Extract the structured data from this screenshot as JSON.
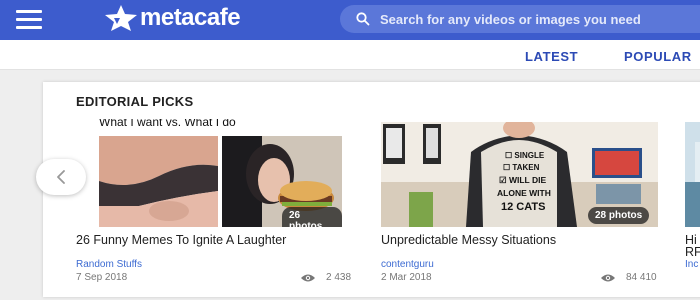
{
  "header": {
    "logo_text": "metacafe",
    "search_placeholder": "Search for any videos or images you need"
  },
  "nav": {
    "latest": "LATEST",
    "popular": "POPULAR"
  },
  "section": {
    "title": "EDITORIAL PICKS"
  },
  "items": [
    {
      "image_caption": "What I want vs. What I do",
      "badge": "26 photos",
      "title": "26 Funny Memes To Ignite A Laughter",
      "source": "Random Stuffs",
      "date": "7 Sep 2018",
      "views": "2 438"
    },
    {
      "image_caption": "☐ SINGLE ☐ TAKEN ☑ WILL DIE ALONE WITH 12 CATS",
      "badge": "28 photos",
      "title": "Unpredictable Messy Situations",
      "source": "contentguru",
      "date": "2 Mar 2018",
      "views": "84 410"
    },
    {
      "title": "Hi",
      "title_line2": "RF",
      "source": "Inc"
    }
  ],
  "colors": {
    "header_bg": "#3d5ccd",
    "link": "#3d6bd2",
    "nav": "#2c4ab5"
  }
}
